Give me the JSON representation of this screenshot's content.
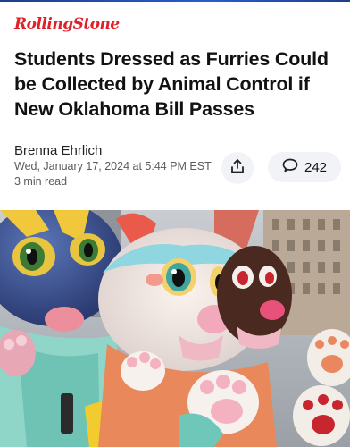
{
  "publication": {
    "name": "RollingStone"
  },
  "article": {
    "headline": "Students Dressed as Furries Could be Collected by Animal Control if New Oklahoma Bill Passes",
    "author": "Brenna Ehrlich",
    "date": "Wed, January 17, 2024 at 5:44 PM EST",
    "read_time": "3 min read"
  },
  "actions": {
    "share_icon": "share-icon",
    "comment_icon": "comment-icon",
    "comment_count": "242"
  },
  "colors": {
    "brand": "#e2202a",
    "button_bg": "#f1f3f6",
    "meta_text": "#5b5b5b"
  },
  "photo": {
    "content": "people wearing furry fursuits"
  }
}
